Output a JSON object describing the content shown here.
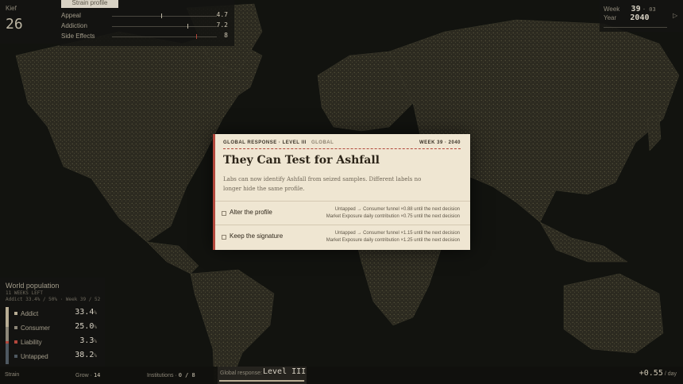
{
  "kief": {
    "label": "Kief",
    "value": "26"
  },
  "strain_profile": {
    "tab": "Strain profile",
    "stats": [
      {
        "label": "Appeal",
        "value": "4.7",
        "level": 0.47
      },
      {
        "label": "Addiction",
        "value": "7.2",
        "level": 0.72
      },
      {
        "label": "Side Effects",
        "value": "8",
        "level": 0.8
      }
    ]
  },
  "time": {
    "week_label": "Week",
    "week": "39",
    "week_suffix": "· 03",
    "year_label": "Year",
    "year": "2040",
    "play_icon": "play-icon"
  },
  "population": {
    "title": "World population",
    "sub1": "11 WEEKS LEFT",
    "sub2": "Addict 33.4% / 50% · Week 39 / 52",
    "rows": [
      {
        "label": "Addict",
        "value": "33.4",
        "unit": "%",
        "color": "#b7ad94"
      },
      {
        "label": "Consumer",
        "value": "25.0",
        "unit": "%",
        "color": "#8d8778"
      },
      {
        "label": "Liability",
        "value": "3.3",
        "unit": "%",
        "color": "#b3473c"
      },
      {
        "label": "Untapped",
        "value": "38.2",
        "unit": "%",
        "color": "#4e5860"
      }
    ]
  },
  "bottom": {
    "strain": "Strain",
    "grow_label": "Grow ·",
    "grow": "14",
    "inst_label": "Institutions ·",
    "inst": "0 / 8",
    "gr_label": "Global response:",
    "gr_level": "Level III",
    "gr_progress": 0.99,
    "rate": "+0.55",
    "rate_unit": "/ day"
  },
  "modal": {
    "kicker": "GLOBAL RESPONSE · LEVEL III",
    "scope": "GLOBAL",
    "week": "WEEK 39 · 2040",
    "title": "They Can Test for Ashfall",
    "body": "Labs can now identify Ashfall from seized samples. Different labels no longer hide the same profile.",
    "options": [
      {
        "label": "Alter the profile",
        "effect1": "Untapped → Consumer funnel ×0.88 until the next decision",
        "effect2": "Market Exposure daily contribution ×0.75 until the next decision"
      },
      {
        "label": "Keep the signature",
        "effect1": "Untapped → Consumer funnel ×1.15 until the next decision",
        "effect2": "Market Exposure daily contribution ×1.25 until the next decision"
      }
    ]
  },
  "colors": {
    "accent": "#b3473c",
    "modal_bg": "#efe6d2",
    "map_bg": "#12130f",
    "land": "#2a281f"
  }
}
